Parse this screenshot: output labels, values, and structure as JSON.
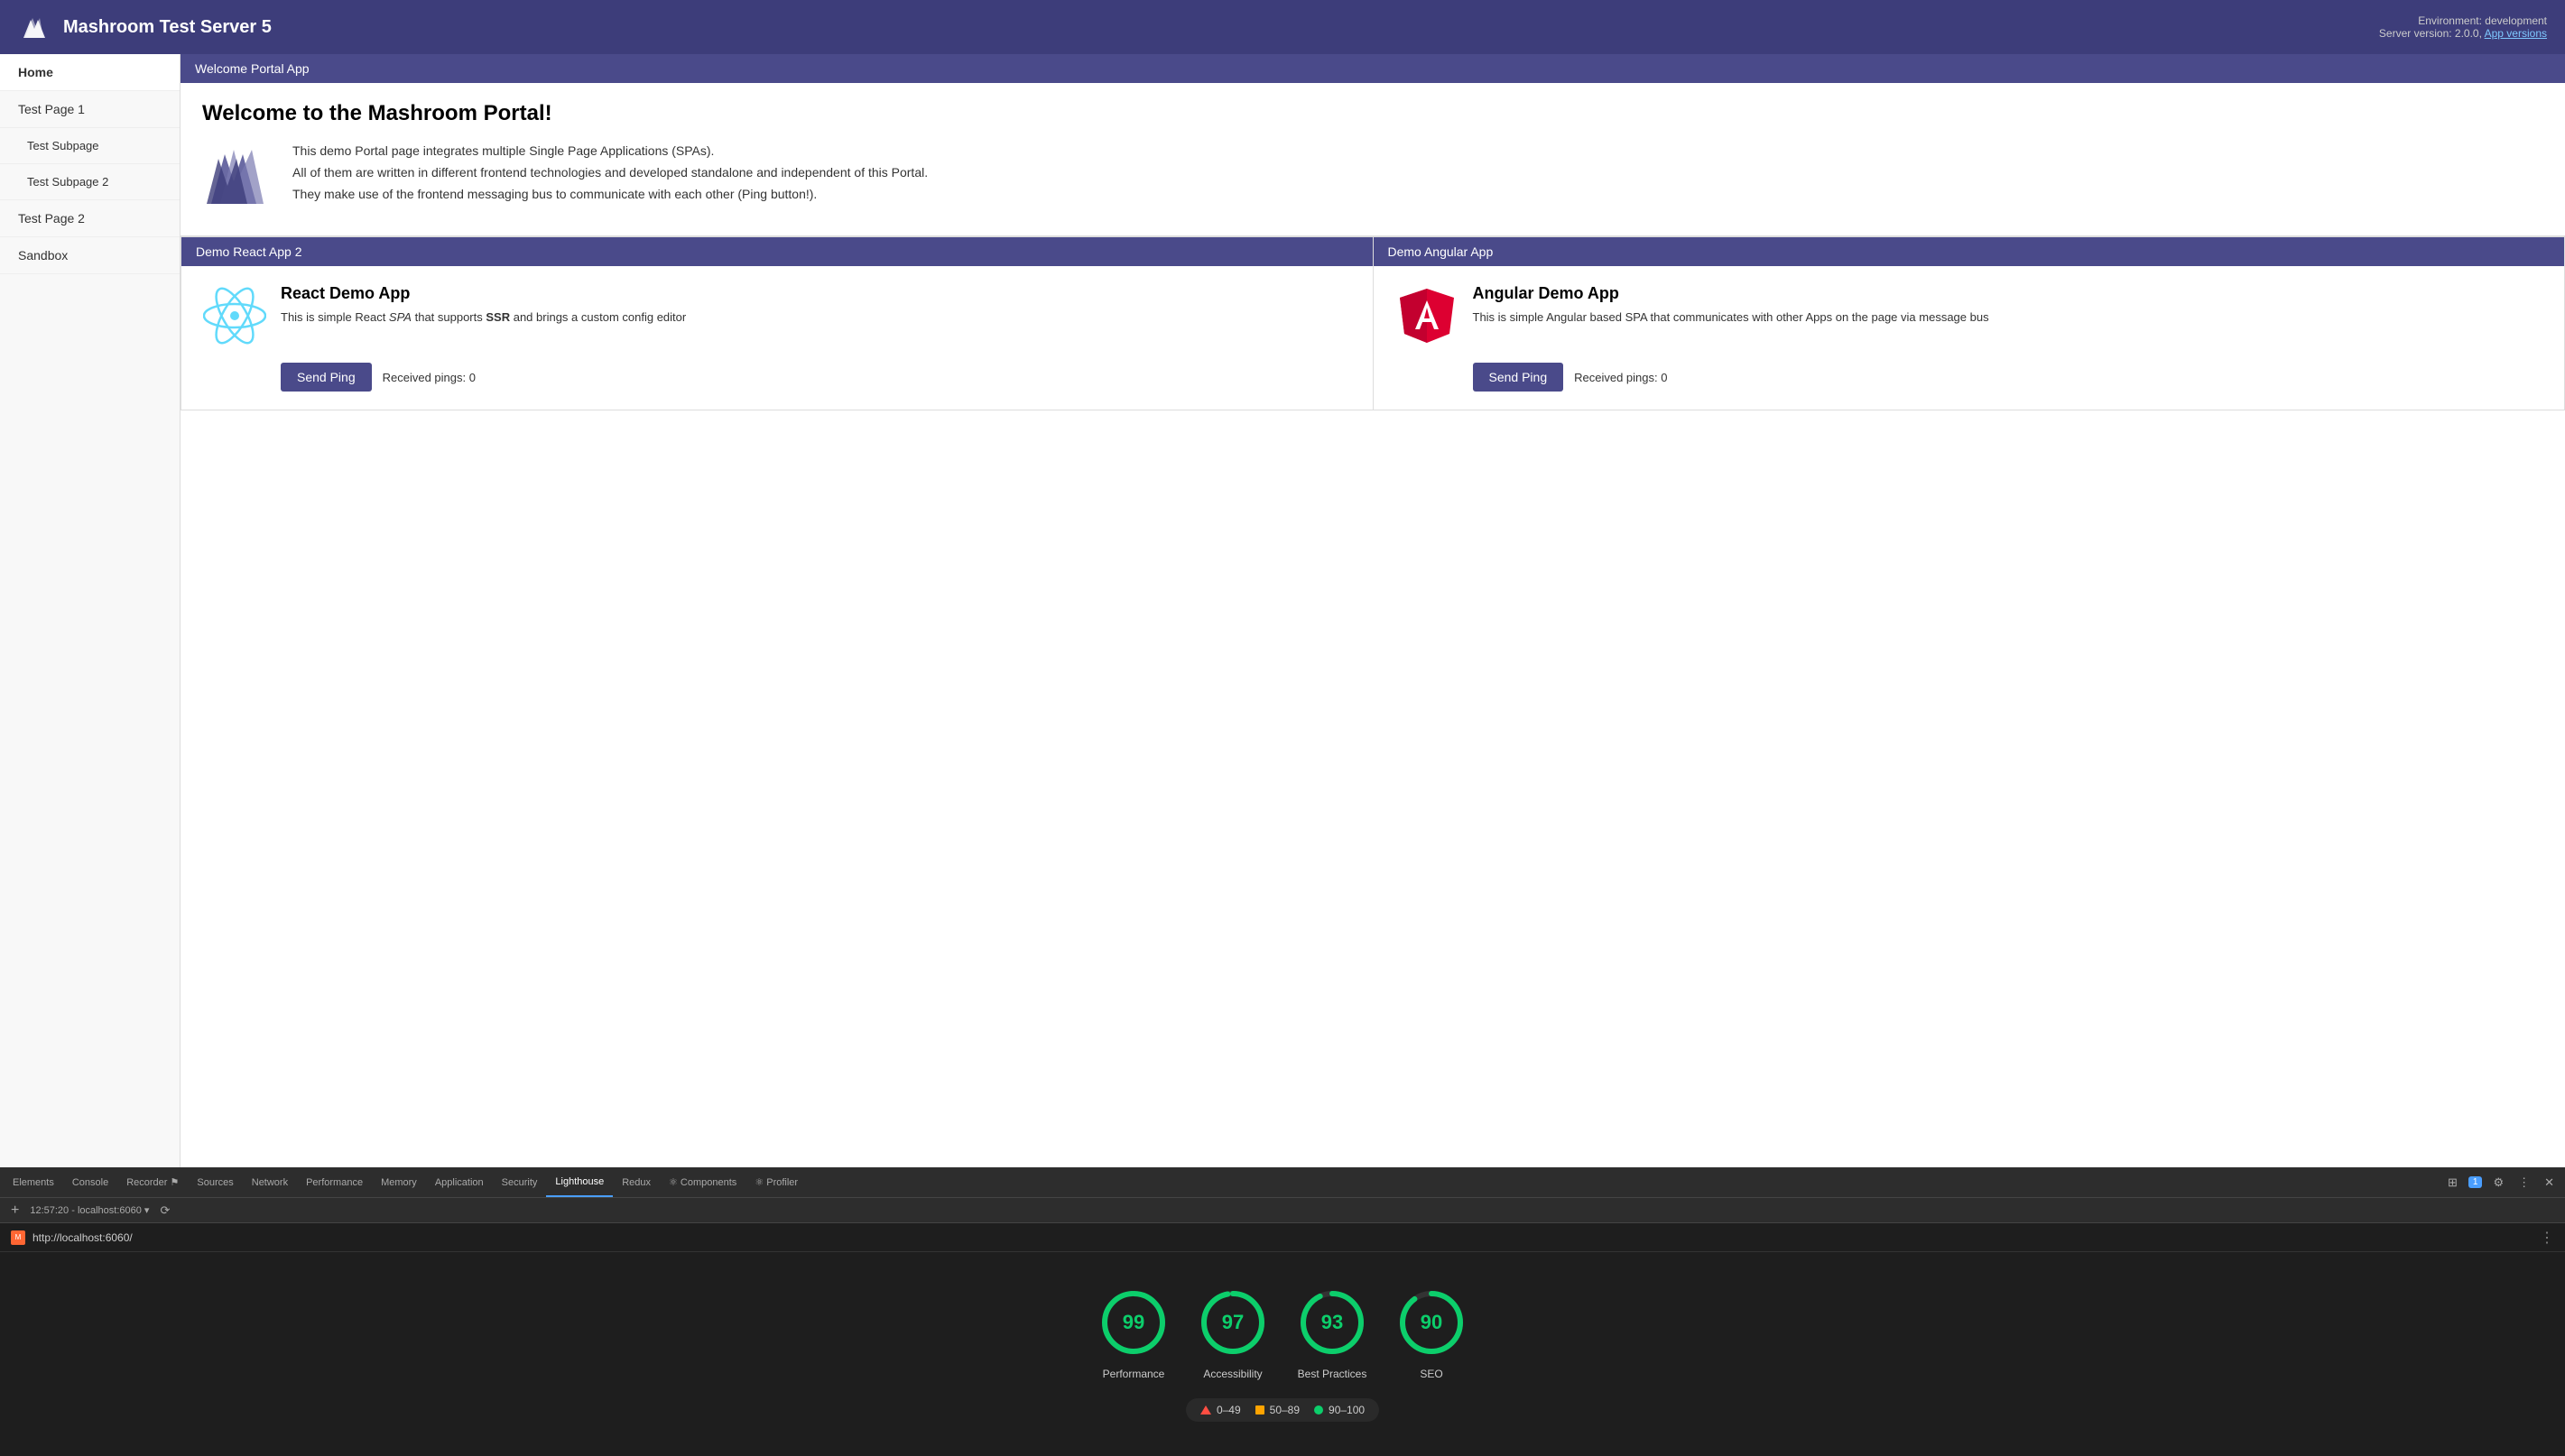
{
  "header": {
    "title": "Mashroom Test Server 5",
    "env_label": "Environment: development",
    "server_label": "Server version: 2.0.0,",
    "app_versions_link": "App versions"
  },
  "sidebar": {
    "items": [
      {
        "label": "Home",
        "active": true,
        "sub": false
      },
      {
        "label": "Test Page 1",
        "active": false,
        "sub": false
      },
      {
        "label": "Test Subpage",
        "active": false,
        "sub": true
      },
      {
        "label": "Test Subpage 2",
        "active": false,
        "sub": true
      },
      {
        "label": "Test Page 2",
        "active": false,
        "sub": false
      },
      {
        "label": "Sandbox",
        "active": false,
        "sub": false
      }
    ]
  },
  "welcome": {
    "section_title": "Welcome Portal App",
    "page_title": "Welcome to the Mashroom Portal!",
    "description_lines": [
      "This demo Portal page integrates multiple Single Page Applications (SPAs).",
      "All of them are written in different frontend technologies and developed standalone and independent of this Portal.",
      "They make use of the frontend messaging bus to communicate with each other (Ping button!)."
    ]
  },
  "react_app": {
    "section_title": "Demo React App 2",
    "title": "React Demo App",
    "description": "This is simple React SPA that supports SSR and brings a custom config editor",
    "button_label": "Send Ping",
    "pings_label": "Received pings: 0"
  },
  "angular_app": {
    "section_title": "Demo Angular App",
    "title": "Angular Demo App",
    "description": "This is simple Angular based SPA that communicates with other Apps on the page via message bus",
    "button_label": "Send Ping",
    "pings_label": "Received pings: 0"
  },
  "devtools": {
    "tabs": [
      {
        "label": "Elements",
        "active": false
      },
      {
        "label": "Console",
        "active": false
      },
      {
        "label": "Recorder ⚑",
        "active": false
      },
      {
        "label": "Sources",
        "active": false
      },
      {
        "label": "Network",
        "active": false
      },
      {
        "label": "Performance",
        "active": false
      },
      {
        "label": "Memory",
        "active": false
      },
      {
        "label": "Application",
        "active": false
      },
      {
        "label": "Security",
        "active": false
      },
      {
        "label": "Lighthouse",
        "active": true
      },
      {
        "label": "Redux",
        "active": false
      },
      {
        "label": "⚛ Components",
        "active": false
      },
      {
        "label": "⚛ Profiler",
        "active": false
      }
    ],
    "toolbar": {
      "timestamp": "12:57:20 - localhost:6060 ▾"
    },
    "url_bar": {
      "url": "http://localhost:6060/"
    }
  },
  "lighthouse": {
    "scores": [
      {
        "label": "Performance",
        "value": 99,
        "circumference": 219.9,
        "pct": 0.99
      },
      {
        "label": "Accessibility",
        "value": 97,
        "circumference": 219.9,
        "pct": 0.97
      },
      {
        "label": "Best Practices",
        "value": 93,
        "circumference": 219.9,
        "pct": 0.93
      },
      {
        "label": "SEO",
        "value": 90,
        "circumference": 219.9,
        "pct": 0.9
      }
    ],
    "legend": [
      {
        "type": "triangle",
        "range": "0–49"
      },
      {
        "type": "square",
        "range": "50–89"
      },
      {
        "type": "dot",
        "range": "90–100"
      }
    ]
  }
}
